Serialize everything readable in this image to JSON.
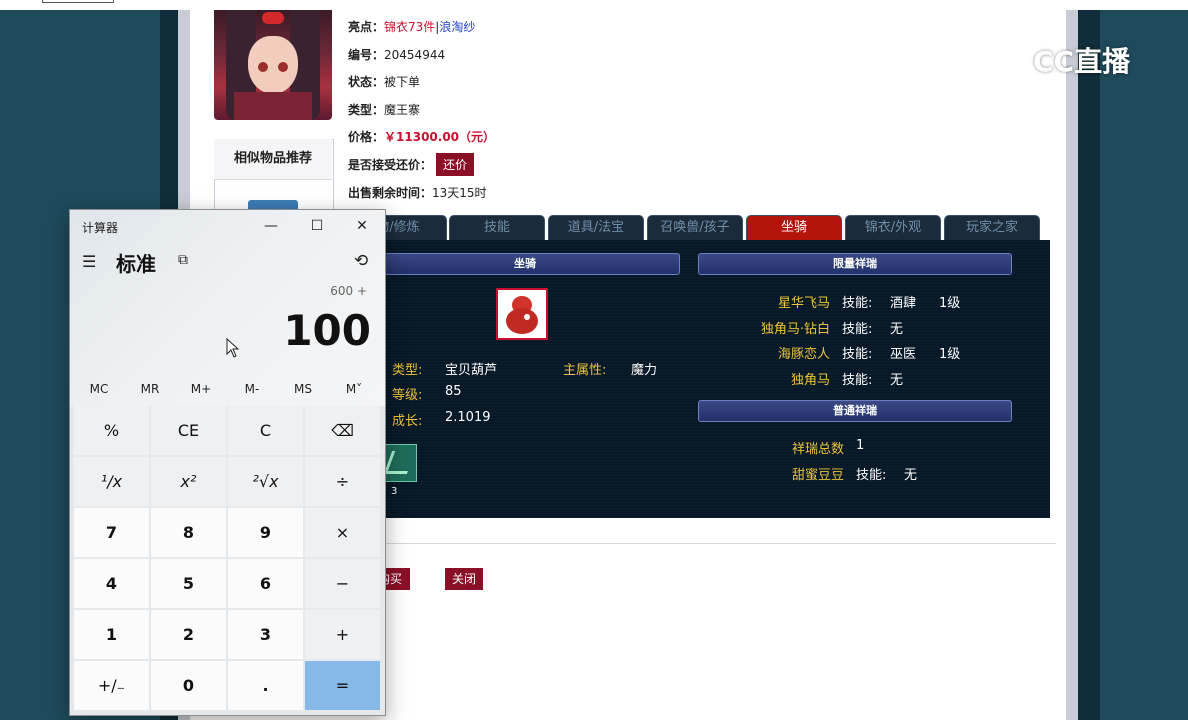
{
  "item": {
    "highlight_label": "亮点：",
    "highlight_value": "锦衣73件",
    "highlight_sep": "|",
    "highlight_extra": "浪淘纱",
    "id_label": "编号：",
    "id_value": "20454944",
    "status_label": "状态：",
    "status_value": "被下单",
    "type_label": "类型：",
    "type_value": "魔王寨",
    "price_label": "价格：",
    "price_value": "￥11300.00（元）",
    "offer_label": "是否接受还价：",
    "offer_button": "还价",
    "remaining_label": "出售剩余时间：",
    "remaining_value": "13天15时"
  },
  "similar": {
    "title": "相似物品推荐"
  },
  "tabs": [
    {
      "label": "物/修炼"
    },
    {
      "label": "技能"
    },
    {
      "label": "道具/法宝"
    },
    {
      "label": "召唤兽/孩子"
    },
    {
      "label": "坐骑"
    },
    {
      "label": "锦衣/外观"
    },
    {
      "label": "玩家之家"
    }
  ],
  "mount_panel": {
    "header": "坐骑",
    "type_label": "类型:",
    "type_value": "宝贝葫芦",
    "main_attr_label": "主属性:",
    "main_attr_value": "魔力",
    "level_label": "等级:",
    "level_value": "85",
    "growth_label": "成长:",
    "growth_value": "2.1019",
    "skill_count": "3"
  },
  "limited_panel": {
    "header": "限量祥瑞",
    "rows": [
      {
        "name": "星华飞马",
        "skill_label": "技能:",
        "skill": "酒肆",
        "level": "1级"
      },
      {
        "name": "独角马·钻白",
        "skill_label": "技能:",
        "skill": "无",
        "level": ""
      },
      {
        "name": "海豚恋人",
        "skill_label": "技能:",
        "skill": "巫医",
        "level": "1级"
      },
      {
        "name": "独角马",
        "skill_label": "技能:",
        "skill": "无",
        "level": ""
      }
    ]
  },
  "normal_panel": {
    "header": "普通祥瑞",
    "total_label": "祥瑞总数",
    "total_value": "1",
    "rows": [
      {
        "name": "甜蜜豆豆",
        "skill_label": "技能:",
        "skill": "无"
      }
    ]
  },
  "actions": {
    "buy": "购买",
    "close": "关闭"
  },
  "logo": {
    "text": "CC直播"
  },
  "calculator": {
    "title": "计算器",
    "minimize": "—",
    "maximize": "☐",
    "close": "✕",
    "menu_icon": "☰",
    "mode": "标准",
    "keep_on_top_icon": "⧉",
    "history_icon": "⟲",
    "expression": "600 +",
    "result": "100",
    "memory": [
      "MC",
      "MR",
      "M+",
      "M-",
      "MS",
      "M˅"
    ],
    "keys": [
      [
        "%",
        "CE",
        "C",
        "⌫"
      ],
      [
        "¹/x",
        "x²",
        "²√x",
        "÷"
      ],
      [
        "7",
        "8",
        "9",
        "×"
      ],
      [
        "4",
        "5",
        "6",
        "−"
      ],
      [
        "1",
        "2",
        "3",
        "+"
      ],
      [
        "+/₋",
        "0",
        ".",
        "="
      ]
    ]
  }
}
